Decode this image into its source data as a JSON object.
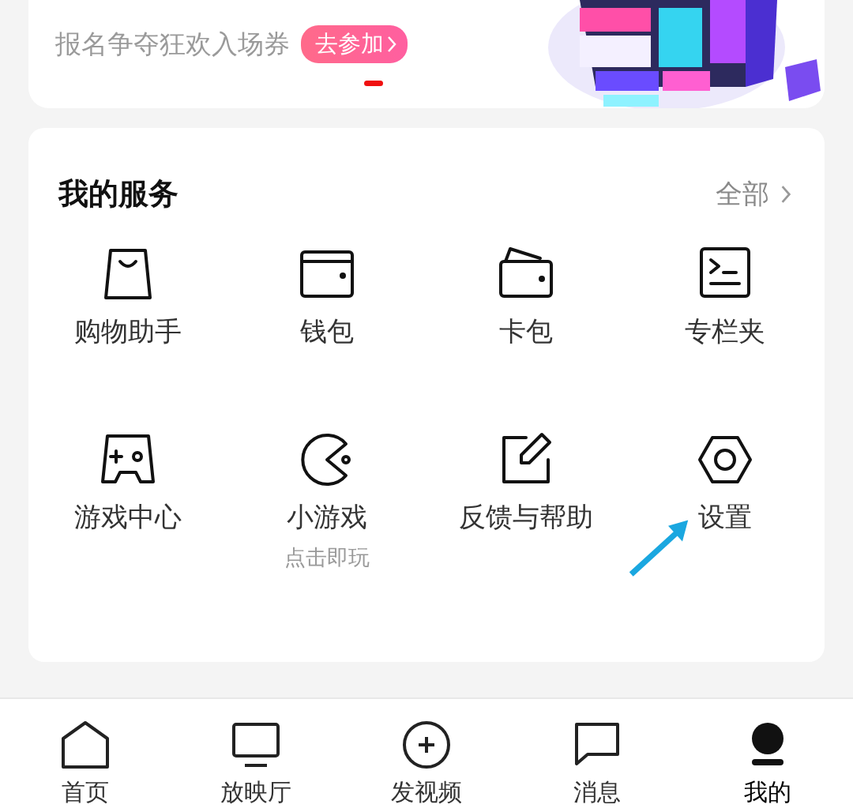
{
  "banner": {
    "subtitle": "报名争夺狂欢入场券",
    "button": "去参加",
    "pager": [
      {
        "selected": true
      }
    ],
    "kind": "picture"
  },
  "services": {
    "title": "我的服务",
    "more": "全部",
    "items": [
      {
        "kind": "bag",
        "label": "购物助手"
      },
      {
        "kind": "wallet",
        "label": "钱包"
      },
      {
        "kind": "cards",
        "label": "卡包"
      },
      {
        "kind": "column",
        "label": "专栏夹"
      },
      {
        "kind": "gamepad",
        "label": "游戏中心"
      },
      {
        "kind": "pacman",
        "label": "小游戏",
        "subtitle": "点击即玩"
      },
      {
        "kind": "feedback",
        "label": "反馈与帮助"
      },
      {
        "kind": "settings",
        "label": "设置",
        "pointer": true
      }
    ]
  },
  "nav": [
    {
      "kind": "home",
      "label": "首页",
      "selected": false
    },
    {
      "kind": "tv",
      "label": "放映厅",
      "selected": false
    },
    {
      "kind": "plus",
      "label": "发视频",
      "selected": false
    },
    {
      "kind": "message",
      "label": "消息",
      "selected": false
    },
    {
      "kind": "me",
      "label": "我的",
      "selected": true
    }
  ]
}
